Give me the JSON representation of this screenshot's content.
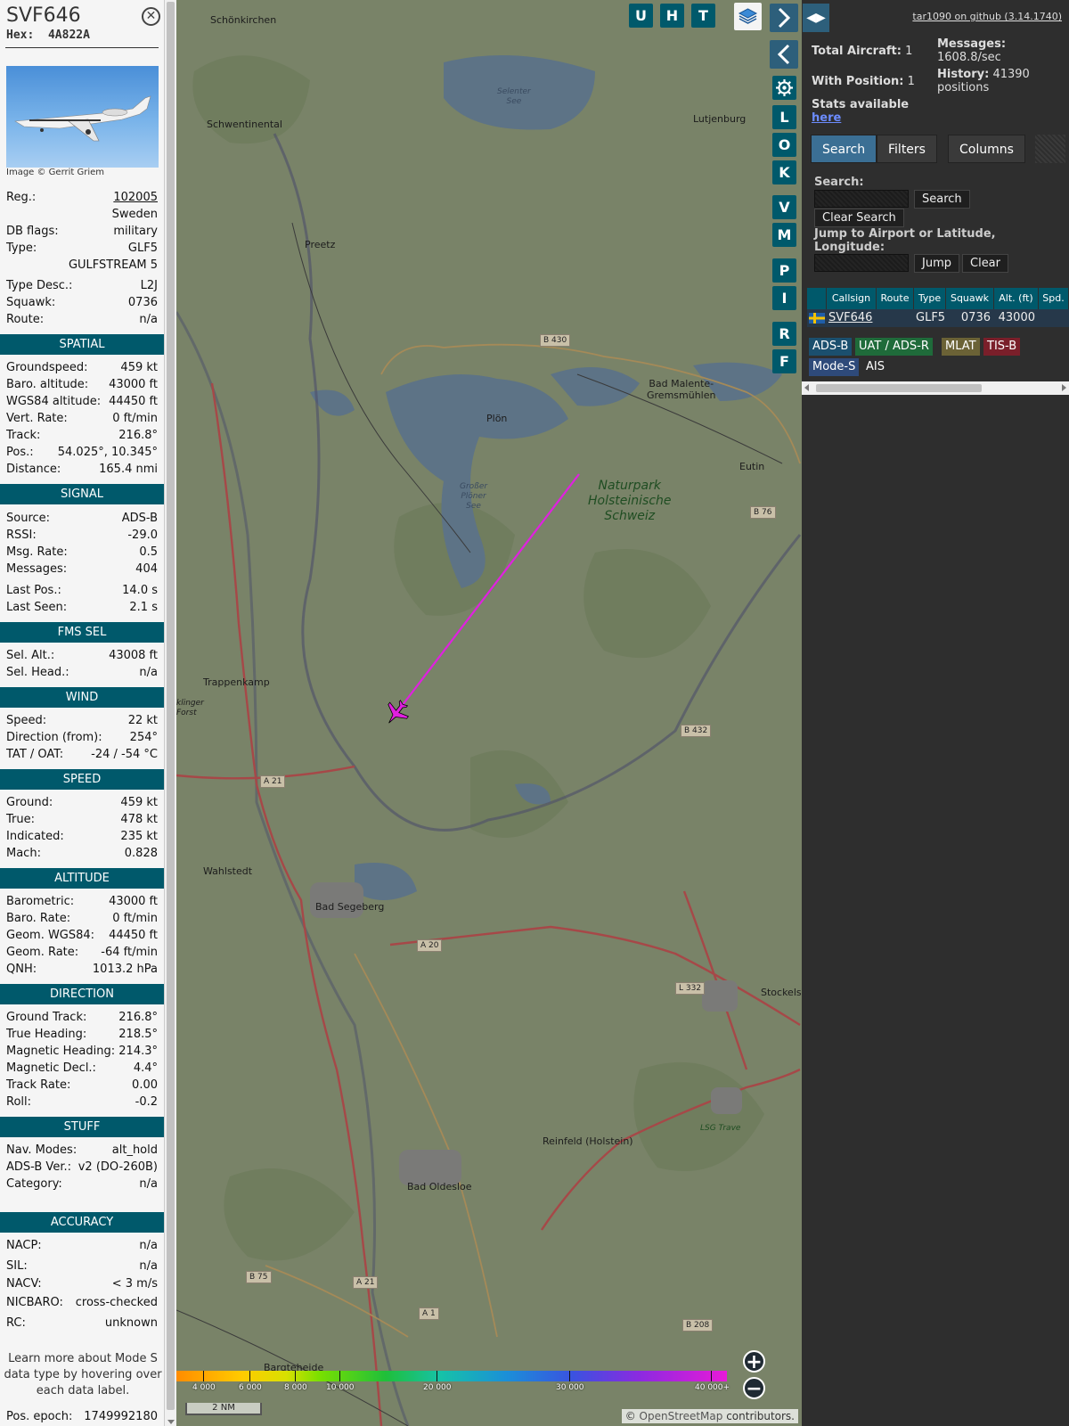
{
  "aircraft": {
    "callsign": "SVF646",
    "hex_label": "Hex:",
    "hex": "4A822A",
    "image_credit": "Image © Gerrit Griem",
    "close_icon": "close-icon"
  },
  "details": {
    "reg_label": "Reg.:",
    "reg": "102005",
    "country": "Sweden",
    "dbflags_label": "DB flags:",
    "dbflags": "military",
    "type_label": "Type:",
    "type": "GLF5",
    "type_name": "GULFSTREAM 5",
    "typedesc_label": "Type Desc.:",
    "typedesc": "L2J",
    "squawk_label": "Squawk:",
    "squawk": "0736",
    "route_label": "Route:",
    "route": "n/a"
  },
  "spatial": {
    "title": "SPATIAL",
    "groundspeed_label": "Groundspeed:",
    "groundspeed": "459 kt",
    "baro_alt_label": "Baro. altitude:",
    "baro_alt": "43000 ft",
    "wgs_alt_label": "WGS84 altitude:",
    "wgs_alt": "44450 ft",
    "vert_rate_label": "Vert. Rate:",
    "vert_rate": "0 ft/min",
    "track_label": "Track:",
    "track": "216.8°",
    "pos_label": "Pos.:",
    "pos": "54.025°, 10.345°",
    "distance_label": "Distance:",
    "distance": "165.4 nmi"
  },
  "signal": {
    "title": "SIGNAL",
    "source_label": "Source:",
    "source": "ADS-B",
    "rssi_label": "RSSI:",
    "rssi": "-29.0",
    "msgrate_label": "Msg. Rate:",
    "msgrate": "0.5",
    "messages_label": "Messages:",
    "messages": "404",
    "lastpos_label": "Last Pos.:",
    "lastpos": "14.0 s",
    "lastseen_label": "Last Seen:",
    "lastseen": "2.1 s"
  },
  "fms": {
    "title": "FMS SEL",
    "selalt_label": "Sel. Alt.:",
    "selalt": "43008 ft",
    "selhead_label": "Sel. Head.:",
    "selhead": "n/a"
  },
  "wind": {
    "title": "WIND",
    "speed_label": "Speed:",
    "speed": "22 kt",
    "dir_label": "Direction (from):",
    "dir": "254°",
    "tat_label": "TAT / OAT:",
    "tat": "-24 / -54 °C"
  },
  "speed": {
    "title": "SPEED",
    "ground_label": "Ground:",
    "ground": "459 kt",
    "true_label": "True:",
    "true": "478 kt",
    "indicated_label": "Indicated:",
    "indicated": "235 kt",
    "mach_label": "Mach:",
    "mach": "0.828"
  },
  "altitude": {
    "title": "ALTITUDE",
    "baro_label": "Barometric:",
    "baro": "43000 ft",
    "barorate_label": "Baro. Rate:",
    "barorate": "0 ft/min",
    "geom_label": "Geom. WGS84:",
    "geom": "44450 ft",
    "geomrate_label": "Geom. Rate:",
    "geomrate": "-64 ft/min",
    "qnh_label": "QNH:",
    "qnh": "1013.2 hPa"
  },
  "direction": {
    "title": "DIRECTION",
    "gtrack_label": "Ground Track:",
    "gtrack": "216.8°",
    "thead_label": "True Heading:",
    "thead": "218.5°",
    "mhead_label": "Magnetic Heading:",
    "mhead": "214.3°",
    "mdecl_label": "Magnetic Decl.:",
    "mdecl": "4.4°",
    "trate_label": "Track Rate:",
    "trate": "0.00",
    "roll_label": "Roll:",
    "roll": "-0.2"
  },
  "stuff": {
    "title": "STUFF",
    "nav_label": "Nav. Modes:",
    "nav": "alt_hold",
    "adsb_label": "ADS-B Ver.:",
    "adsb": "v2 (DO-260B)",
    "cat_label": "Category:",
    "cat": "n/a"
  },
  "accuracy": {
    "title": "ACCURACY",
    "nacp_label": "NACP:",
    "nacp": "n/a",
    "sil_label": "SIL:",
    "sil": "n/a",
    "nacv_label": "NACV:",
    "nacv": "< 3 m/s",
    "nic_label": "NICBARO:",
    "nic": "cross-checked",
    "rc_label": "RC:",
    "rc": "unknown"
  },
  "learn_more": "Learn more about Mode S data type by hovering over each data label.",
  "pos_epoch_label": "Pos. epoch:",
  "pos_epoch": "1749992180",
  "map": {
    "buttons_top": [
      "U",
      "H",
      "T"
    ],
    "buttons_side": [
      "L",
      "O",
      "K",
      "V",
      "M",
      "P",
      "I",
      "R",
      "F"
    ],
    "places": {
      "schonkirchen": "Schönkirchen",
      "schwentinental": "Schwentinental",
      "selenter": "Selenter\nSee",
      "lutjenburg": "Lutjenburg",
      "preetz": "Preetz",
      "plon": "Plön",
      "grosser": "Großer\nPlöner\nSee",
      "malente": "Bad Malente-\nGremsmühlen",
      "eutin": "Eutin",
      "trappenkamp": "Trappenkamp",
      "klinger": "klinger\nForst",
      "wahlstedt": "Wahlstedt",
      "segeberg": "Bad Segeberg",
      "stockelsdorf": "Stockelsd",
      "reinfeld": "Reinfeld (Holstein)",
      "oldesloe": "Bad Oldesloe",
      "bargteheide": "Bargteheide",
      "lsg": "LSG Trave"
    },
    "nature_park": "Naturpark\nHolsteinische\nSchweiz",
    "roads": {
      "b430": "B 430",
      "b76": "B 76",
      "b432": "B 432",
      "a21a": "A 21",
      "a20": "A 20",
      "l332": "L 332",
      "b75": "B 75",
      "a21b": "A 21",
      "a1": "A 1",
      "b208": "B 208"
    },
    "altitude_scale": [
      "4 000",
      "6 000",
      "8 000",
      "10 000",
      "20 000",
      "30 000",
      "40 000+"
    ],
    "scale_bar": "2 NM",
    "attribution_prefix": "© ",
    "attribution_link": "OpenStreetMap",
    "attribution_suffix": " contributors."
  },
  "right": {
    "github": "tar1090 on github (3.14.1740)",
    "total_label": "Total Aircraft:",
    "total": "1",
    "withpos_label": "With Position:",
    "withpos": "1",
    "messages_label": "Messages:",
    "messages": "1608.8/sec",
    "history_label": "History:",
    "history": "41390 positions",
    "stats_text": "Stats available",
    "stats_link": "here",
    "tabs": [
      "Search",
      "Filters",
      "Columns"
    ],
    "search_label": "Search:",
    "search_button": "Search",
    "clear_search_button": "Clear Search",
    "jump_label": "Jump to Airport or Latitude, Longitude:",
    "jump_button": "Jump",
    "clear_button": "Clear",
    "table_headers": [
      "Callsign",
      "Route",
      "Type",
      "Squawk",
      "Alt. (ft)",
      "Spd."
    ],
    "table_row": {
      "callsign": "SVF646",
      "route": "",
      "type": "GLF5",
      "squawk": "0736",
      "alt": "43000"
    },
    "source_chips": [
      "ADS-B",
      "UAT / ADS-R",
      "MLAT",
      "TIS-B",
      "Mode-S",
      "AIS"
    ],
    "chip_colors": [
      "#1b4f6e",
      "#1f6b3a",
      "#6b6236",
      "#7a1f2a",
      "#2e4a7a",
      "#2e2e2e"
    ]
  }
}
